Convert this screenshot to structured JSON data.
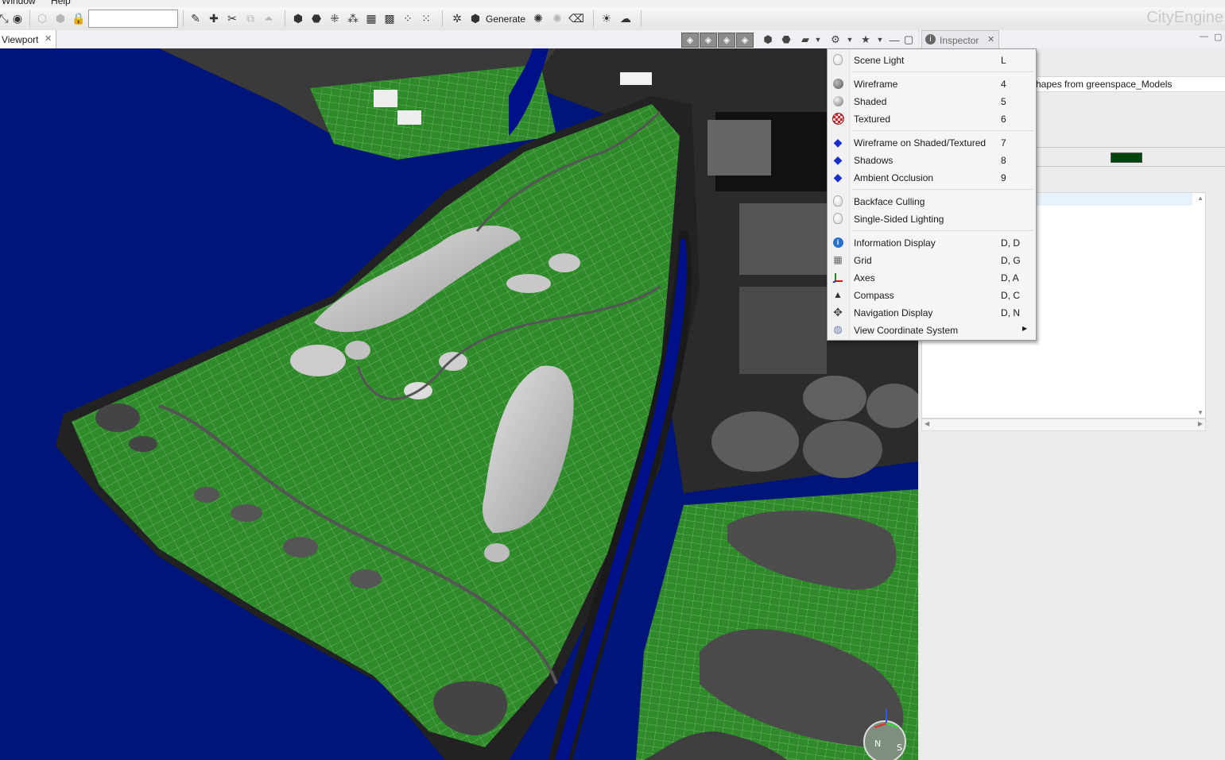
{
  "menubar": {
    "items": [
      "Window",
      "Help"
    ]
  },
  "toolbar": {
    "generate_label": "Generate",
    "search_value": ""
  },
  "brand": "CityEngine",
  "viewport": {
    "tab_label": "Viewport"
  },
  "inspector": {
    "tab_label": "Inspector",
    "field_value": "hapes from greenspace_Models",
    "swatch_color": "#00440f"
  },
  "menu": {
    "items": [
      {
        "label": "Scene Light",
        "accel": "L",
        "icon": "bulb-icon"
      },
      {
        "label": "Wireframe",
        "accel": "4",
        "icon": "gray-sphere-icon"
      },
      {
        "label": "Shaded",
        "accel": "5",
        "icon": "shaded-sphere-icon"
      },
      {
        "label": "Textured",
        "accel": "6",
        "icon": "textured-sphere-icon"
      },
      {
        "label": "Wireframe on Shaded/Textured",
        "accel": "7",
        "icon": "blue-cube-icon"
      },
      {
        "label": "Shadows",
        "accel": "8",
        "icon": "blue-cube-icon"
      },
      {
        "label": "Ambient Occlusion",
        "accel": "9",
        "icon": "blue-cube-icon"
      },
      {
        "label": "Backface Culling",
        "accel": "",
        "icon": "bulb-icon"
      },
      {
        "label": "Single-Sided Lighting",
        "accel": "",
        "icon": "bulb-icon"
      },
      {
        "label": "Information Display",
        "accel": "D, D",
        "icon": "info-icon"
      },
      {
        "label": "Grid",
        "accel": "D, G",
        "icon": "grid-icon"
      },
      {
        "label": "Axes",
        "accel": "D, A",
        "icon": "axes-icon"
      },
      {
        "label": "Compass",
        "accel": "D, C",
        "icon": "compass-icon"
      },
      {
        "label": "Navigation Display",
        "accel": "D, N",
        "icon": "navigation-icon"
      },
      {
        "label": "View Coordinate System",
        "accel": "",
        "icon": "globe-icon",
        "submenu": true
      }
    ]
  },
  "colors": {
    "water": "#00157a",
    "terrain": "#2f8a2a",
    "menu_bg": "#f5f5f5"
  }
}
